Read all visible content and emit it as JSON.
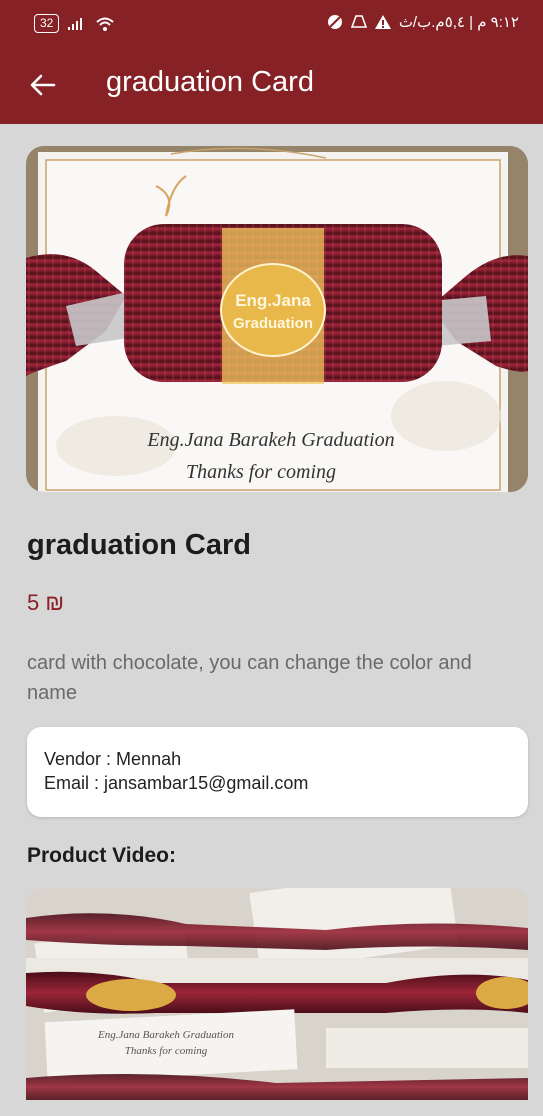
{
  "status_bar": {
    "battery": "32",
    "time_text": "٩:١٢ م | ٥,٤م.ب/ث"
  },
  "appbar": {
    "title": "graduation Card",
    "color": "#862226"
  },
  "product": {
    "title": "graduation Card",
    "price": "5 ₪",
    "description": "card with chocolate, you can change the color and name",
    "image_text": {
      "sticker_line1": "Eng.Jana",
      "sticker_line2": "Graduation",
      "card_line1": "Eng.Jana Barakeh Graduation",
      "card_line2": "Thanks for coming"
    }
  },
  "vendor": {
    "vendor_line": "Vendor : Mennah",
    "email_line": "Email : jansambar15@gmail.com"
  },
  "video": {
    "heading": "Product Video:",
    "frame_text_line1": "Eng.Jana Barakeh Graduation",
    "frame_text_line2": "Thanks for coming"
  },
  "colors": {
    "background": "#d7d7d7",
    "accent": "#862226",
    "price": "#8a1f25"
  }
}
